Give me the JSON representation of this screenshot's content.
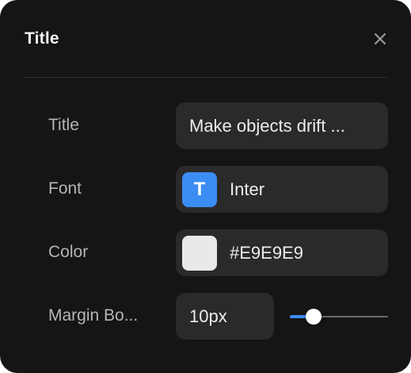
{
  "panel": {
    "title": "Title"
  },
  "rows": {
    "title": {
      "label": "Title",
      "value": "Make objects drift ..."
    },
    "font": {
      "label": "Font",
      "icon_letter": "T",
      "value": "Inter",
      "icon_color": "#3b8cf3"
    },
    "color": {
      "label": "Color",
      "value": "#E9E9E9",
      "swatch_color": "#E9E9E9"
    },
    "margin_bottom": {
      "label": "Margin Bo...",
      "value": "10px",
      "slider_fraction": 0.16
    }
  },
  "icons": {
    "close": "close-icon",
    "font": "text-type-icon"
  },
  "colors": {
    "background": "#151515",
    "field": "#2a2a2a",
    "accent": "#3b8cf3"
  }
}
